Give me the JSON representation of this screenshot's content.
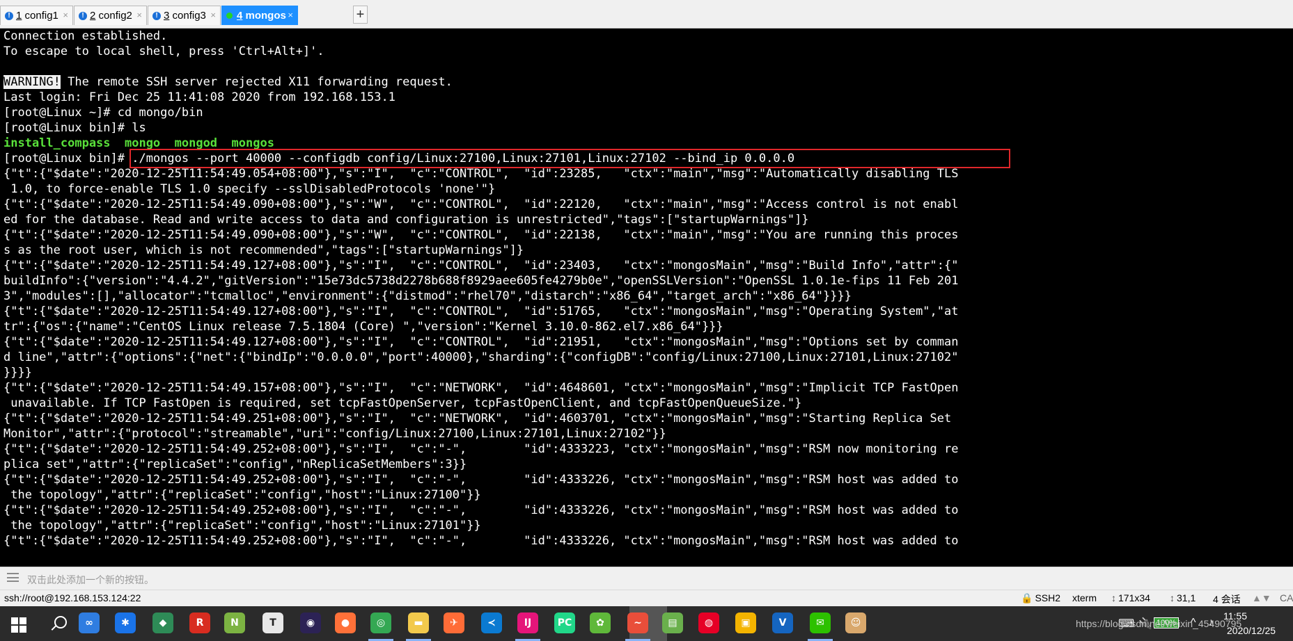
{
  "tabs": [
    {
      "icon": "info-icon",
      "num": "1",
      "name": " config1",
      "active": false
    },
    {
      "icon": "info-icon",
      "num": "2",
      "name": " config2",
      "active": false
    },
    {
      "icon": "info-icon",
      "num": "3",
      "name": " config3",
      "active": false
    },
    {
      "icon": "connected-dot-icon",
      "num": "4",
      "name": " mongos",
      "active": true
    }
  ],
  "tab_close_glyph": "×",
  "tab_add_glyph": "+",
  "terminal": {
    "lines": [
      "Connection established.",
      "To escape to local shell, press 'Ctrl+Alt+]'.",
      "",
      {
        "badge": "WARNING!",
        "text": " The remote SSH server rejected X11 forwarding request."
      },
      "Last login: Fri Dec 25 11:41:08 2020 from 192.168.153.1",
      "[root@Linux ~]# cd mongo/bin",
      "[root@Linux bin]# ls",
      {
        "green": "install_compass  mongo  mongod  mongos"
      },
      "[root@Linux bin]# ./mongos --port 40000 --configdb config/Linux:27100,Linux:27101,Linux:27102 --bind_ip 0.0.0.0",
      "{\"t\":{\"$date\":\"2020-12-25T11:54:49.054+08:00\"},\"s\":\"I\",  \"c\":\"CONTROL\",  \"id\":23285,   \"ctx\":\"main\",\"msg\":\"Automatically disabling TLS",
      " 1.0, to force-enable TLS 1.0 specify --sslDisabledProtocols 'none'\"}",
      "{\"t\":{\"$date\":\"2020-12-25T11:54:49.090+08:00\"},\"s\":\"W\",  \"c\":\"CONTROL\",  \"id\":22120,   \"ctx\":\"main\",\"msg\":\"Access control is not enabl",
      "ed for the database. Read and write access to data and configuration is unrestricted\",\"tags\":[\"startupWarnings\"]}",
      "{\"t\":{\"$date\":\"2020-12-25T11:54:49.090+08:00\"},\"s\":\"W\",  \"c\":\"CONTROL\",  \"id\":22138,   \"ctx\":\"main\",\"msg\":\"You are running this proces",
      "s as the root user, which is not recommended\",\"tags\":[\"startupWarnings\"]}",
      "{\"t\":{\"$date\":\"2020-12-25T11:54:49.127+08:00\"},\"s\":\"I\",  \"c\":\"CONTROL\",  \"id\":23403,   \"ctx\":\"mongosMain\",\"msg\":\"Build Info\",\"attr\":{\"",
      "buildInfo\":{\"version\":\"4.4.2\",\"gitVersion\":\"15e73dc5738d2278b688f8929aee605fe4279b0e\",\"openSSLVersion\":\"OpenSSL 1.0.1e-fips 11 Feb 201",
      "3\",\"modules\":[],\"allocator\":\"tcmalloc\",\"environment\":{\"distmod\":\"rhel70\",\"distarch\":\"x86_64\",\"target_arch\":\"x86_64\"}}}}",
      "{\"t\":{\"$date\":\"2020-12-25T11:54:49.127+08:00\"},\"s\":\"I\",  \"c\":\"CONTROL\",  \"id\":51765,   \"ctx\":\"mongosMain\",\"msg\":\"Operating System\",\"at",
      "tr\":{\"os\":{\"name\":\"CentOS Linux release 7.5.1804 (Core) \",\"version\":\"Kernel 3.10.0-862.el7.x86_64\"}}}",
      "{\"t\":{\"$date\":\"2020-12-25T11:54:49.127+08:00\"},\"s\":\"I\",  \"c\":\"CONTROL\",  \"id\":21951,   \"ctx\":\"mongosMain\",\"msg\":\"Options set by comman",
      "d line\",\"attr\":{\"options\":{\"net\":{\"bindIp\":\"0.0.0.0\",\"port\":40000},\"sharding\":{\"configDB\":\"config/Linux:27100,Linux:27101,Linux:27102\"",
      "}}}}",
      "{\"t\":{\"$date\":\"2020-12-25T11:54:49.157+08:00\"},\"s\":\"I\",  \"c\":\"NETWORK\",  \"id\":4648601, \"ctx\":\"mongosMain\",\"msg\":\"Implicit TCP FastOpen",
      " unavailable. If TCP FastOpen is required, set tcpFastOpenServer, tcpFastOpenClient, and tcpFastOpenQueueSize.\"}",
      "{\"t\":{\"$date\":\"2020-12-25T11:54:49.251+08:00\"},\"s\":\"I\",  \"c\":\"NETWORK\",  \"id\":4603701, \"ctx\":\"mongosMain\",\"msg\":\"Starting Replica Set",
      "Monitor\",\"attr\":{\"protocol\":\"streamable\",\"uri\":\"config/Linux:27100,Linux:27101,Linux:27102\"}}",
      "{\"t\":{\"$date\":\"2020-12-25T11:54:49.252+08:00\"},\"s\":\"I\",  \"c\":\"-\",        \"id\":4333223, \"ctx\":\"mongosMain\",\"msg\":\"RSM now monitoring re",
      "plica set\",\"attr\":{\"replicaSet\":\"config\",\"nReplicaSetMembers\":3}}",
      "{\"t\":{\"$date\":\"2020-12-25T11:54:49.252+08:00\"},\"s\":\"I\",  \"c\":\"-\",        \"id\":4333226, \"ctx\":\"mongosMain\",\"msg\":\"RSM host was added to",
      " the topology\",\"attr\":{\"replicaSet\":\"config\",\"host\":\"Linux:27100\"}}",
      "{\"t\":{\"$date\":\"2020-12-25T11:54:49.252+08:00\"},\"s\":\"I\",  \"c\":\"-\",        \"id\":4333226, \"ctx\":\"mongosMain\",\"msg\":\"RSM host was added to",
      " the topology\",\"attr\":{\"replicaSet\":\"config\",\"host\":\"Linux:27101\"}}",
      "{\"t\":{\"$date\":\"2020-12-25T11:54:49.252+08:00\"},\"s\":\"I\",  \"c\":\"-\",        \"id\":4333226, \"ctx\":\"mongosMain\",\"msg\":\"RSM host was added to"
    ]
  },
  "quickbar": {
    "hint": "双击此处添加一个新的按钮。"
  },
  "statusbar": {
    "connection": "ssh://root@192.168.153.124:22",
    "protocol": "SSH2",
    "term": "xterm",
    "size": "171x34",
    "cursor": "31,1",
    "sessions": "4 会话",
    "caps": "CA"
  },
  "taskbar": {
    "apps": [
      {
        "name": "baidu-netdisk-icon",
        "glyph": "∞",
        "color": "#2f7de1"
      },
      {
        "name": "bluetooth-app-icon",
        "glyph": "✱",
        "color": "#1a73e8"
      },
      {
        "name": "kite-app-icon",
        "glyph": "◆",
        "color": "#2e8b57"
      },
      {
        "name": "redis-icon",
        "glyph": "R",
        "color": "#d82c20"
      },
      {
        "name": "notepad-plus-icon",
        "glyph": "N",
        "color": "#7cb342"
      },
      {
        "name": "typora-icon",
        "glyph": "T",
        "color": "#e8e8e8"
      },
      {
        "name": "eclipse-icon",
        "glyph": "◉",
        "color": "#2c2255"
      },
      {
        "name": "firefox-icon",
        "glyph": "●",
        "color": "#ff7139"
      },
      {
        "name": "chrome-icon",
        "glyph": "◎",
        "color": "#34a853"
      },
      {
        "name": "file-explorer-icon",
        "glyph": "▬",
        "color": "#f2c94c"
      },
      {
        "name": "postman-icon",
        "glyph": "✈",
        "color": "#ff6c37"
      },
      {
        "name": "vscode-icon",
        "glyph": "≺",
        "color": "#0b7ad1"
      },
      {
        "name": "intellij-icon",
        "glyph": "IJ",
        "color": "#e5157a"
      },
      {
        "name": "pycharm-icon",
        "glyph": "PC",
        "color": "#21d789"
      },
      {
        "name": "tortoise-icon",
        "glyph": "✿",
        "color": "#5fb83a"
      },
      {
        "name": "xshell-icon",
        "glyph": "~",
        "color": "#e94e3a"
      },
      {
        "name": "xftp-icon",
        "glyph": "▤",
        "color": "#6ab04c"
      },
      {
        "name": "netease-music-icon",
        "glyph": "◍",
        "color": "#e60026"
      },
      {
        "name": "sticky-notes-icon",
        "glyph": "▣",
        "color": "#f4b400"
      },
      {
        "name": "vmware-icon",
        "glyph": "V",
        "color": "#1565c0"
      },
      {
        "name": "wechat-icon",
        "glyph": "✉",
        "color": "#2dc100"
      },
      {
        "name": "avatar-app-icon",
        "glyph": "☺",
        "color": "#d9a86c"
      }
    ],
    "battery": "100%",
    "time": "11:55",
    "date": "2020/12/25"
  },
  "watermark": "https://blog.csdn.net/weixin_45490795"
}
